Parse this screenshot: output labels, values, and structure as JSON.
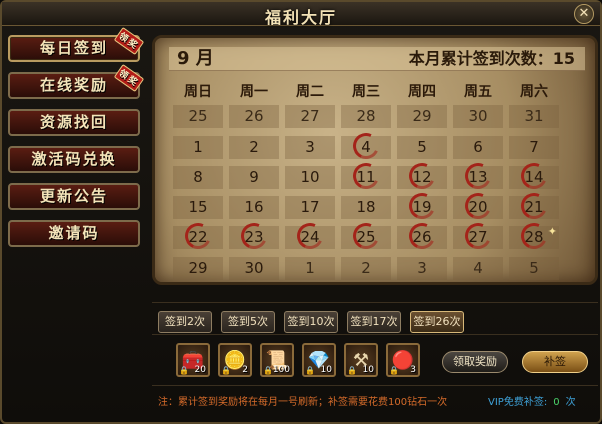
{
  "window": {
    "title": "福利大厅",
    "close": "✕"
  },
  "sidebar": {
    "items": [
      {
        "label": "每日签到",
        "ribbon": "领奖",
        "active": true
      },
      {
        "label": "在线奖励",
        "ribbon": "领奖",
        "active": false
      },
      {
        "label": "资源找回",
        "ribbon": "",
        "active": false
      },
      {
        "label": "激活码兑换",
        "ribbon": "",
        "active": false
      },
      {
        "label": "更新公告",
        "ribbon": "",
        "active": false
      },
      {
        "label": "邀请码",
        "ribbon": "",
        "active": false
      }
    ]
  },
  "calendar": {
    "month_label": "9 月",
    "total_label": "本月累计签到次数：15",
    "weekdays": [
      "周日",
      "周一",
      "周二",
      "周三",
      "周四",
      "周五",
      "周六"
    ],
    "weeks": [
      [
        {
          "d": "25",
          "other": true,
          "signed": false
        },
        {
          "d": "26",
          "other": true,
          "signed": false
        },
        {
          "d": "27",
          "other": true,
          "signed": false
        },
        {
          "d": "28",
          "other": true,
          "signed": false
        },
        {
          "d": "29",
          "other": true,
          "signed": false
        },
        {
          "d": "30",
          "other": true,
          "signed": false
        },
        {
          "d": "31",
          "other": true,
          "signed": false
        }
      ],
      [
        {
          "d": "1",
          "other": false,
          "signed": false
        },
        {
          "d": "2",
          "other": false,
          "signed": false
        },
        {
          "d": "3",
          "other": false,
          "signed": false
        },
        {
          "d": "4",
          "other": false,
          "signed": true
        },
        {
          "d": "5",
          "other": false,
          "signed": false
        },
        {
          "d": "6",
          "other": false,
          "signed": false
        },
        {
          "d": "7",
          "other": false,
          "signed": false
        }
      ],
      [
        {
          "d": "8",
          "other": false,
          "signed": false
        },
        {
          "d": "9",
          "other": false,
          "signed": false
        },
        {
          "d": "10",
          "other": false,
          "signed": false
        },
        {
          "d": "11",
          "other": false,
          "signed": true
        },
        {
          "d": "12",
          "other": false,
          "signed": true
        },
        {
          "d": "13",
          "other": false,
          "signed": true
        },
        {
          "d": "14",
          "other": false,
          "signed": true
        }
      ],
      [
        {
          "d": "15",
          "other": false,
          "signed": false
        },
        {
          "d": "16",
          "other": false,
          "signed": false
        },
        {
          "d": "17",
          "other": false,
          "signed": false
        },
        {
          "d": "18",
          "other": false,
          "signed": false
        },
        {
          "d": "19",
          "other": false,
          "signed": true
        },
        {
          "d": "20",
          "other": false,
          "signed": true
        },
        {
          "d": "21",
          "other": false,
          "signed": true
        }
      ],
      [
        {
          "d": "22",
          "other": false,
          "signed": true
        },
        {
          "d": "23",
          "other": false,
          "signed": true
        },
        {
          "d": "24",
          "other": false,
          "signed": true
        },
        {
          "d": "25",
          "other": false,
          "signed": true
        },
        {
          "d": "26",
          "other": false,
          "signed": true
        },
        {
          "d": "27",
          "other": false,
          "signed": true
        },
        {
          "d": "28",
          "other": false,
          "signed": true,
          "today": true
        }
      ],
      [
        {
          "d": "29",
          "other": false,
          "signed": false
        },
        {
          "d": "30",
          "other": false,
          "signed": false
        },
        {
          "d": "1",
          "other": true,
          "signed": false
        },
        {
          "d": "2",
          "other": true,
          "signed": false
        },
        {
          "d": "3",
          "other": true,
          "signed": false
        },
        {
          "d": "4",
          "other": true,
          "signed": false
        },
        {
          "d": "5",
          "other": true,
          "signed": false
        }
      ]
    ]
  },
  "milestones": {
    "tabs": [
      {
        "label": "签到2次",
        "active": false
      },
      {
        "label": "签到5次",
        "active": false
      },
      {
        "label": "签到10次",
        "active": false
      },
      {
        "label": "签到17次",
        "active": false
      },
      {
        "label": "签到26次",
        "active": true
      }
    ]
  },
  "rewards": {
    "items": [
      {
        "icon": "treasure-chest-icon",
        "glyph": "🧰",
        "count": "20"
      },
      {
        "icon": "gold-coin-icon",
        "glyph": "🪙",
        "count": "2"
      },
      {
        "icon": "scroll-icon",
        "glyph": "📜",
        "count": "100"
      },
      {
        "icon": "purple-crystal-icon",
        "glyph": "💎",
        "count": "10"
      },
      {
        "icon": "forging-hammer-icon",
        "glyph": "⚒",
        "count": "10"
      },
      {
        "icon": "red-gem-icon",
        "glyph": "🔴",
        "count": "3"
      }
    ],
    "lock_glyph": "🔒",
    "claim_label": "领取奖励",
    "makeup_label": "补签"
  },
  "footer": {
    "note": "注：累计签到奖励将在每月一号刷新；补签需要花费100钻石一次",
    "vip_label": "VIP免费补签:",
    "vip_value": "0",
    "vip_unit": "次"
  }
}
